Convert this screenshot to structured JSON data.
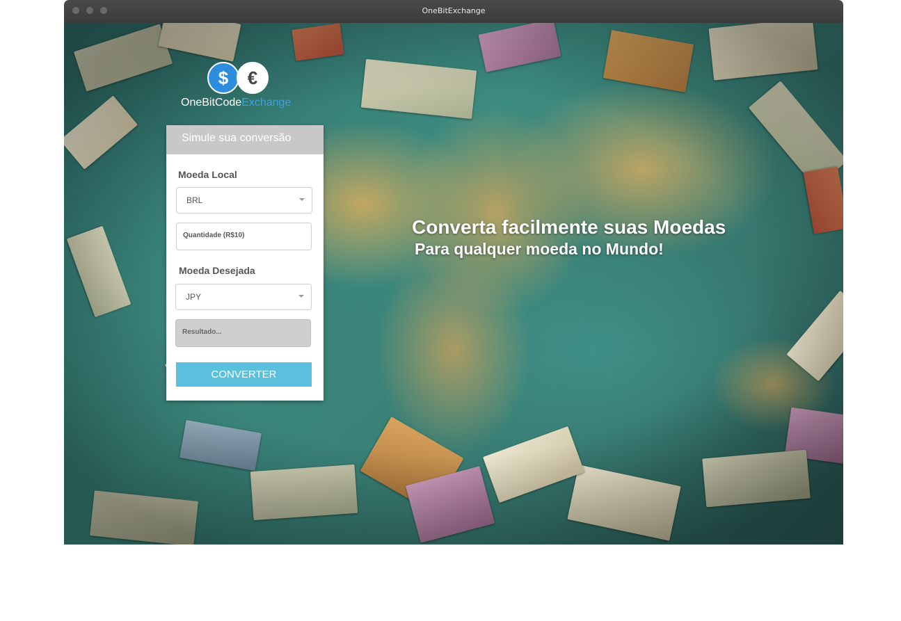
{
  "window": {
    "title": "OneBitExchange"
  },
  "logo": {
    "usd_symbol": "$",
    "eur_symbol": "€",
    "name_part1": "OneBitCode",
    "name_part2": "Exchange"
  },
  "form": {
    "title": "Simule sua conversão",
    "local_label": "Moeda Local",
    "local_currency": "BRL",
    "quantity_placeholder": "Quantidade (R$10)",
    "target_label": "Moeda Desejada",
    "target_currency": "JPY",
    "result_placeholder": "Resultado...",
    "convert_label": "CONVERTER"
  },
  "hero": {
    "headline": "Converta facilmente suas Moedas",
    "subheadline": "Para qualquer moeda no Mundo!"
  },
  "colors": {
    "accent": "#5bc0de",
    "logo_blue": "#3aa3e6",
    "titlebar": "#3b3b3b"
  }
}
